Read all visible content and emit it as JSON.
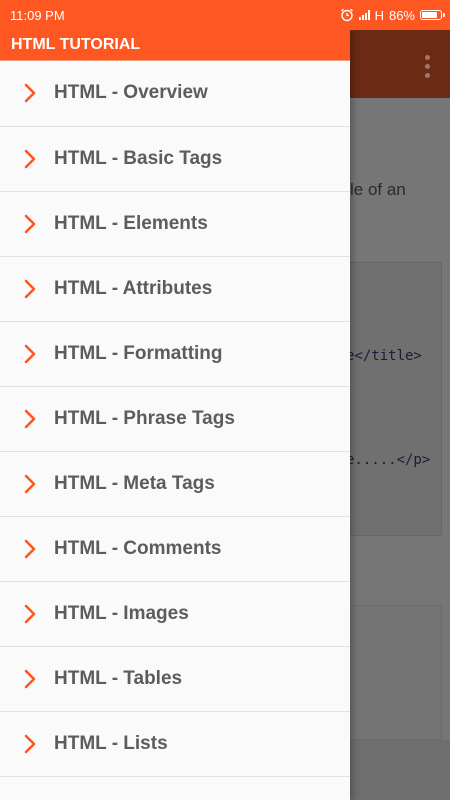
{
  "status_bar": {
    "time": "11:09 PM",
    "network": "H",
    "battery": "86%",
    "battery_level": 0.86
  },
  "drawer": {
    "title": "HTML TUTORIAL",
    "items": [
      {
        "label": "HTML - Overview",
        "icon": "chevron-right-icon"
      },
      {
        "label": "HTML - Basic Tags",
        "icon": "chevron-right-icon"
      },
      {
        "label": "HTML - Elements",
        "icon": "chevron-right-icon"
      },
      {
        "label": "HTML - Attributes",
        "icon": "chevron-right-icon"
      },
      {
        "label": "HTML - Formatting",
        "icon": "chevron-right-icon"
      },
      {
        "label": "HTML - Phrase Tags",
        "icon": "chevron-right-icon"
      },
      {
        "label": "HTML - Meta Tags",
        "icon": "chevron-right-icon"
      },
      {
        "label": "HTML - Comments",
        "icon": "chevron-right-icon"
      },
      {
        "label": "HTML - Images",
        "icon": "chevron-right-icon"
      },
      {
        "label": "HTML - Tables",
        "icon": "chevron-right-icon"
      },
      {
        "label": "HTML - Lists",
        "icon": "chevron-right-icon"
      }
    ]
  },
  "background": {
    "text_fragment": "le of an",
    "code_line_1": "e</title>",
    "code_line_2": "e.....</p>"
  },
  "colors": {
    "accent": "#ff5722",
    "chevron": "#ff5722",
    "label": "#5c5c5c"
  }
}
